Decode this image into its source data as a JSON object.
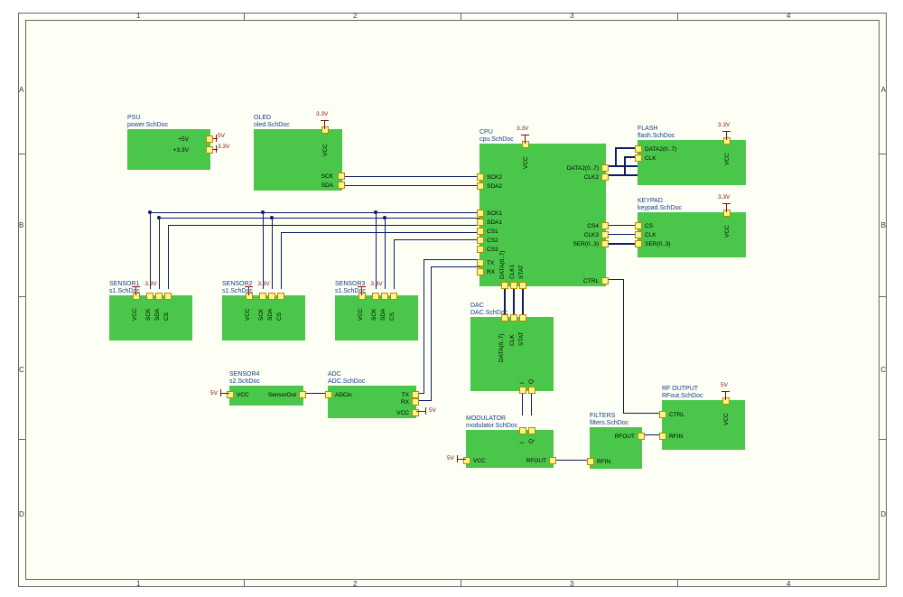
{
  "border": {
    "cols": [
      "1",
      "2",
      "3",
      "4"
    ],
    "rows": [
      "A",
      "B",
      "C",
      "D"
    ]
  },
  "blocks": {
    "psu": {
      "title": "PSU",
      "file": "power.SchDoc",
      "p5v": "+5V",
      "p33v": "+3.3V"
    },
    "oled": {
      "title": "OLED",
      "file": "oled.SchDoc",
      "sck": "SCK",
      "sda": "SDA",
      "vcc": "VCC"
    },
    "cpu": {
      "title": "CPU",
      "file": "cpu.SchDoc",
      "sck2": "SCK2",
      "sda2": "SDA2",
      "sck1": "SCK1",
      "sda1": "SDA1",
      "cs1": "CS1",
      "cs2": "CS2",
      "cs3": "CS3",
      "tx": "TX",
      "rx": "RX",
      "data2": "DATA2(0..7)",
      "clk2": "CLK2",
      "cs4": "CS4",
      "clk3": "CLK3",
      "ser": "SER(0..3)",
      "ctrl": "CTRL",
      "vcc": "VCC",
      "data": "DATA(0..7)",
      "clk1": "CLK1",
      "stat": "STAT"
    },
    "flash": {
      "title": "FLASH",
      "file": "flash.SchDoc",
      "data2": "DATA2(0..7)",
      "clk": "CLK",
      "vcc": "VCC"
    },
    "keypad": {
      "title": "KEYPAD",
      "file": "keypad.SchDoc",
      "cs": "CS",
      "clk": "CLK",
      "ser": "SER(0..3)",
      "vcc": "VCC"
    },
    "sensor1": {
      "title": "SENSOR1",
      "file": "s1.SchDoc",
      "vcc": "VCC",
      "sck": "SCK",
      "sda": "SDA",
      "cs": "CS"
    },
    "sensor2": {
      "title": "SENSOR2",
      "file": "s1.SchDoc",
      "vcc": "VCC",
      "sck": "SCK",
      "sda": "SDA",
      "cs": "CS"
    },
    "sensor3": {
      "title": "SENSOR3",
      "file": "s1.SchDoc",
      "vcc": "VCC",
      "sck": "SCK",
      "sda": "SDA",
      "cs": "CS"
    },
    "sensor4": {
      "title": "SENSOR4",
      "file": "s2.SchDoc",
      "vcc": "VCC",
      "out": "SensorOut"
    },
    "adc": {
      "title": "ADC",
      "file": "ADC.SchDoc",
      "in": "ADCin",
      "tx": "TX",
      "rx": "RX",
      "vcc": "VCC"
    },
    "dac": {
      "title": "DAC",
      "file": "DAC.SchDoc",
      "data": "DATA(0..7)",
      "clk": "CLK",
      "stat": "STAT",
      "i": "I",
      "q": "Q"
    },
    "mod": {
      "title": "MODULATOR",
      "file": "modulator.SchDoc",
      "vcc": "VCC",
      "rfout": "RFOUT",
      "i": "I",
      "q": "Q"
    },
    "filters": {
      "title": "FILTERS",
      "file": "filters.SchDoc",
      "rfin": "RFIN",
      "rfout": "RFOUT"
    },
    "rfout": {
      "title": "RF OUTPUT",
      "file": "RFout.SchDoc",
      "ctrl": "CTRL",
      "rfin": "RFIN",
      "vcc": "VCC"
    }
  },
  "power": {
    "v5": "5V",
    "v33": "3.3V"
  }
}
